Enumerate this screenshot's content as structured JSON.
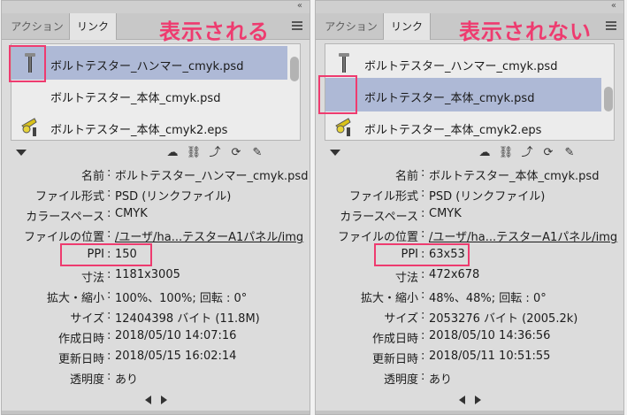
{
  "panels": [
    {
      "annotation": "表示される",
      "tabs": [
        "アクション",
        "リンク"
      ],
      "collapse": "«",
      "links": [
        "ボルトテスター_ハンマー_cmyk.psd",
        "ボルトテスター_本体_cmyk.psd",
        "ボルトテスター_本体_cmyk2.eps"
      ],
      "selected_index": 0,
      "info": [
        {
          "label": "名前",
          "value": "ボルトテスター_ハンマー_cmyk.psd"
        },
        {
          "label": "ファイル形式",
          "value": "PSD (リンクファイル)"
        },
        {
          "label": "カラースペース",
          "value": "CMYK"
        },
        {
          "label": "ファイルの位置",
          "value": "/ユーザ/ha...テスターA1パネル/img"
        },
        {
          "label": "PPI",
          "value": "150"
        },
        {
          "label": "寸法",
          "value": "1181x3005"
        },
        {
          "label": "拡大・縮小",
          "value": "100%、100%; 回転 : 0°"
        },
        {
          "label": "サイズ",
          "value": "12404398 バイト (11.8M)"
        },
        {
          "label": "作成日時",
          "value": "2018/05/10 14:07:16"
        },
        {
          "label": "更新日時",
          "value": "2018/05/15 16:02:14"
        },
        {
          "label": "透明度",
          "value": "あり"
        }
      ]
    },
    {
      "annotation": "表示されない",
      "tabs": [
        "アクション",
        "リンク"
      ],
      "collapse": "«",
      "links": [
        "ボルトテスター_ハンマー_cmyk.psd",
        "ボルトテスター_本体_cmyk.psd",
        "ボルトテスター_本体_cmyk2.eps"
      ],
      "selected_index": 1,
      "info": [
        {
          "label": "名前",
          "value": "ボルトテスター_本体_cmyk.psd"
        },
        {
          "label": "ファイル形式",
          "value": "PSD (リンクファイル)"
        },
        {
          "label": "カラースペース",
          "value": "CMYK"
        },
        {
          "label": "ファイルの位置",
          "value": "/ユーザ/ha...テスターA1パネル/img"
        },
        {
          "label": "PPI",
          "value": "63x53"
        },
        {
          "label": "寸法",
          "value": "472x678"
        },
        {
          "label": "拡大・縮小",
          "value": "48%、48%; 回転 : 0°"
        },
        {
          "label": "サイズ",
          "value": "2053276 バイト (2005.2k)"
        },
        {
          "label": "作成日時",
          "value": "2018/05/10 14:36:56"
        },
        {
          "label": "更新日時",
          "value": "2018/05/11 10:51:55"
        },
        {
          "label": "透明度",
          "value": "あり"
        }
      ]
    }
  ],
  "colors": {
    "accent_annotation": "#ee3b6f",
    "selection": "#aeb9d6"
  }
}
